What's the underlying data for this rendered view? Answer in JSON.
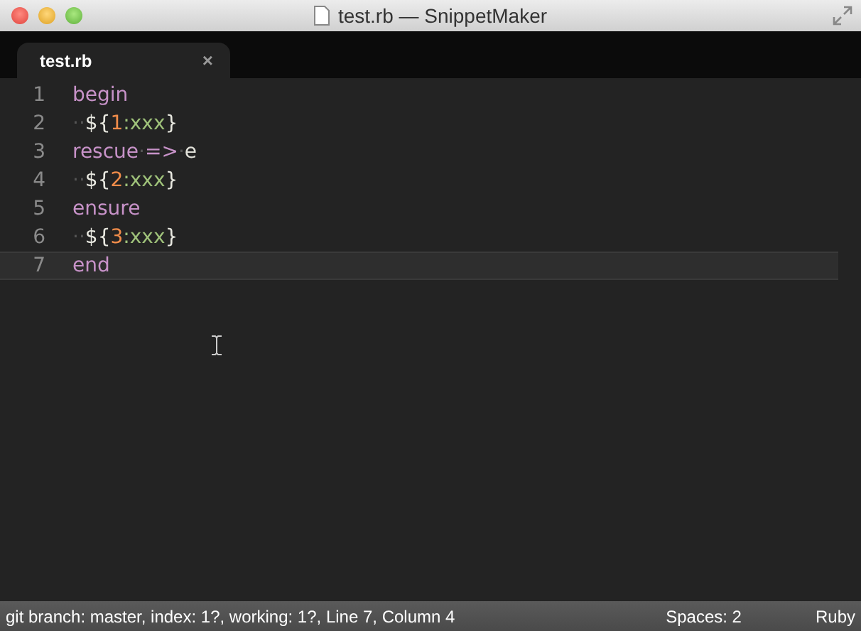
{
  "window": {
    "title": "test.rb — SnippetMaker"
  },
  "tabs": [
    {
      "label": "test.rb",
      "close": "×",
      "selected": true
    }
  ],
  "editor": {
    "lines": [
      {
        "number": "1",
        "current": false,
        "tokens": [
          {
            "kind": "keyword",
            "text": "begin"
          }
        ]
      },
      {
        "number": "2",
        "current": false,
        "tokens": [
          {
            "kind": "space",
            "text": "··"
          },
          {
            "kind": "punct",
            "text": "${"
          },
          {
            "kind": "number",
            "text": "1"
          },
          {
            "kind": "string",
            "text": ":xxx"
          },
          {
            "kind": "punct",
            "text": "}"
          }
        ]
      },
      {
        "number": "3",
        "current": false,
        "tokens": [
          {
            "kind": "keyword",
            "text": "rescue"
          },
          {
            "kind": "space",
            "text": "·"
          },
          {
            "kind": "operator",
            "text": "=>"
          },
          {
            "kind": "space",
            "text": "·"
          },
          {
            "kind": "plain",
            "text": "e"
          }
        ]
      },
      {
        "number": "4",
        "current": false,
        "tokens": [
          {
            "kind": "space",
            "text": "··"
          },
          {
            "kind": "punct",
            "text": "${"
          },
          {
            "kind": "number",
            "text": "2"
          },
          {
            "kind": "string",
            "text": ":xxx"
          },
          {
            "kind": "punct",
            "text": "}"
          }
        ]
      },
      {
        "number": "5",
        "current": false,
        "tokens": [
          {
            "kind": "keyword",
            "text": "ensure"
          }
        ]
      },
      {
        "number": "6",
        "current": false,
        "tokens": [
          {
            "kind": "space",
            "text": "··"
          },
          {
            "kind": "punct",
            "text": "${"
          },
          {
            "kind": "number",
            "text": "3"
          },
          {
            "kind": "string",
            "text": ":xxx"
          },
          {
            "kind": "punct",
            "text": "}"
          }
        ]
      },
      {
        "number": "7",
        "current": true,
        "tokens": [
          {
            "kind": "keyword",
            "text": "end"
          }
        ]
      }
    ]
  },
  "status_bar": {
    "left": "git branch: master, index: 1?, working: 1?, Line 7, Column 4",
    "spaces": "Spaces: 2",
    "syntax": "Ruby"
  }
}
